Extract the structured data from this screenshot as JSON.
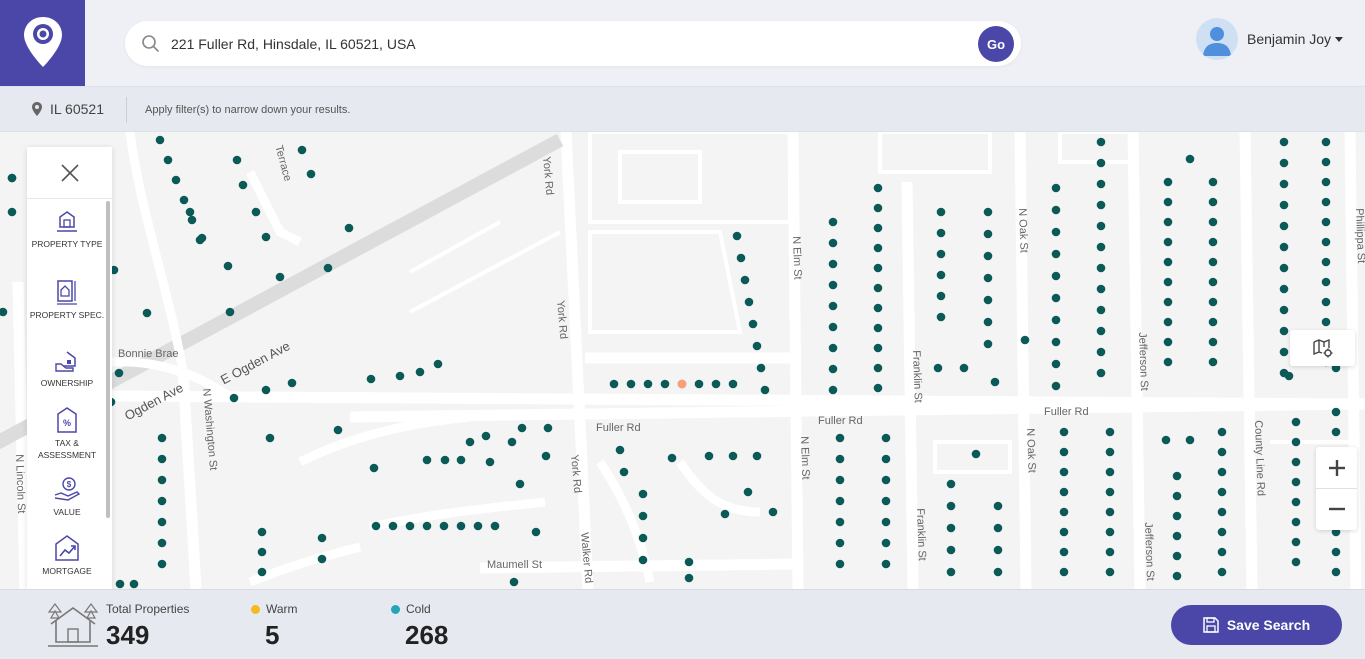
{
  "header": {
    "search_value": "221 Fuller Rd, Hinsdale, IL 60521, USA",
    "go_label": "Go",
    "user_name": "Benjamin Joy"
  },
  "filterbar": {
    "location": "IL 60521",
    "hint": "Apply filter(s) to narrow down your results."
  },
  "panel": {
    "items": [
      {
        "label": "PROPERTY TYPE",
        "icon": "property-type-icon"
      },
      {
        "label": "PROPERTY SPEC.",
        "icon": "property-spec-icon"
      },
      {
        "label": "OWNERSHIP",
        "icon": "ownership-icon"
      },
      {
        "label": "TAX & ASSESSMENT",
        "icon": "tax-assessment-icon"
      },
      {
        "label": "VALUE",
        "icon": "value-icon"
      },
      {
        "label": "MORTGAGE",
        "icon": "mortgage-icon"
      }
    ]
  },
  "map": {
    "streets": [
      "York Rd",
      "York Rd",
      "York Rd",
      "Ogden Ave",
      "E Ogden Ave",
      "Bonnie Brae",
      "N Washington St",
      "N Lincoln St",
      "Fuller Rd",
      "Fuller Rd",
      "Fuller Rd",
      "N Elm St",
      "N Elm St",
      "Franklin St",
      "Franklin St",
      "N Oak St",
      "N Oak St",
      "Jefferson St",
      "Jefferson St",
      "County Line Rd",
      "Phillippa St",
      "Maumell St",
      "Walker Rd",
      "Terrace"
    ],
    "colors": {
      "property": "#0b5a58",
      "highlight": "#f4a07f",
      "road": "#ffffff",
      "highway": "#dcdcdc",
      "background": "#f4f4f4"
    }
  },
  "footer": {
    "total_label": "Total Properties",
    "total_value": "349",
    "warm_label": "Warm",
    "warm_value": "5",
    "cold_label": "Cold",
    "cold_value": "268",
    "save_label": "Save Search",
    "colors": {
      "warm": "#f6b91e",
      "cold": "#26a5b8",
      "accent": "#4b47a8"
    }
  }
}
